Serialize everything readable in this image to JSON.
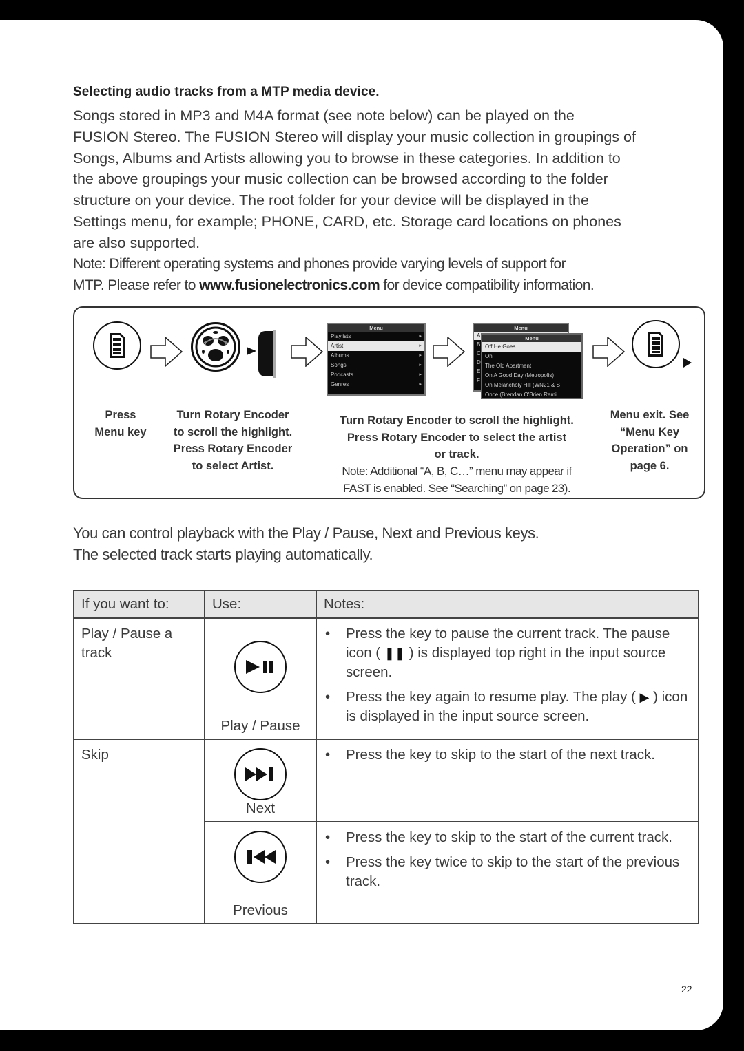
{
  "heading": "Selecting audio tracks from a MTP media device.",
  "intro_lines": [
    "Songs stored in MP3 and M4A format (see note below) can be played on the",
    "FUSION Stereo. The FUSION Stereo will display your music collection in groupings of",
    "Songs, Albums and Artists allowing you to browse in these categories. In addition to",
    "the above groupings your music collection can be browsed according to the folder",
    "structure on your device. The root folder for your device will be displayed in the",
    "Settings menu, for example; PHONE, CARD, etc. Storage card locations on phones",
    "are also supported."
  ],
  "note": {
    "line1": "Note: Different operating systems and phones provide varying levels of support for",
    "line2_pre": "MTP. Please refer to ",
    "link": "www.fusionelectronics.com",
    "line2_post": " for device compatibility information."
  },
  "diagram": {
    "icons": [
      "menu-key-icon",
      "rotary-encoder-icon",
      "encoder-knob-icon",
      "menu-key-icon"
    ],
    "screen1": {
      "title": "Menu",
      "items": [
        {
          "label": "Playlists",
          "selected": false
        },
        {
          "label": "Artist",
          "selected": true
        },
        {
          "label": "Albums",
          "selected": false
        },
        {
          "label": "Songs",
          "selected": false
        },
        {
          "label": "Podcasts",
          "selected": false
        },
        {
          "label": "Genres",
          "selected": false
        }
      ]
    },
    "screen2": {
      "back_title": "Menu",
      "back_letters": [
        "A",
        "B",
        "C",
        "D",
        "E",
        "F"
      ],
      "title": "Menu",
      "items": [
        {
          "label": "Off He Goes",
          "selected": true
        },
        {
          "label": "Oh",
          "selected": false
        },
        {
          "label": "The Old Apartment",
          "selected": false
        },
        {
          "label": "On A Good Day (Metropolis)",
          "selected": false
        },
        {
          "label": "On Melancholy Hill (WN21 & S",
          "selected": false
        },
        {
          "label": "Once (Brendan O'Brien Remi",
          "selected": false
        }
      ]
    },
    "captions": {
      "step1": [
        "Press",
        "Menu key"
      ],
      "step2": [
        "Turn Rotary Encoder",
        "to scroll the highlight.",
        "Press Rotary Encoder",
        "to select Artist."
      ],
      "step3": [
        "Turn Rotary Encoder to scroll the highlight.",
        "Press Rotary Encoder to select the artist",
        "or track."
      ],
      "step3_note": [
        "Note: Additional “A, B, C…” menu may appear if",
        "FAST is enabled. See “Searching” on page 23)."
      ],
      "step4": [
        "Menu exit. See",
        "“Menu Key",
        "Operation” on",
        "page 6."
      ]
    }
  },
  "control_text": [
    "You can control playback with the Play / Pause, Next and Previous keys.",
    "The selected track starts playing automatically."
  ],
  "table": {
    "headers": [
      "If you want to:",
      "Use:",
      "Notes:"
    ],
    "rows": [
      {
        "want": "Play / Pause a track",
        "key_icon": "play-pause-icon",
        "key_label": "Play / Pause",
        "notes": [
          {
            "pre": "Press the key to pause the current track. The pause icon ( ",
            "glyph": "❚❚",
            "post": " ) is displayed top right in the input source screen."
          },
          {
            "pre": "Press the key again to resume play. The play ( ",
            "glyph": "▶",
            "post": " ) icon is displayed in the input source screen."
          }
        ]
      },
      {
        "want": "Skip",
        "key_icon": "next-track-icon",
        "key_label": "Next",
        "notes": [
          {
            "pre": "Press the key to skip to the start of the next track.",
            "glyph": "",
            "post": ""
          }
        ]
      },
      {
        "want": "",
        "key_icon": "previous-track-icon",
        "key_label": "Previous",
        "notes": [
          {
            "pre": "Press the key to skip to the start of the current track.",
            "glyph": "",
            "post": ""
          },
          {
            "pre": "Press the key twice to skip to the start of the previous track.",
            "glyph": "",
            "post": ""
          }
        ]
      }
    ]
  },
  "page_number": "22"
}
